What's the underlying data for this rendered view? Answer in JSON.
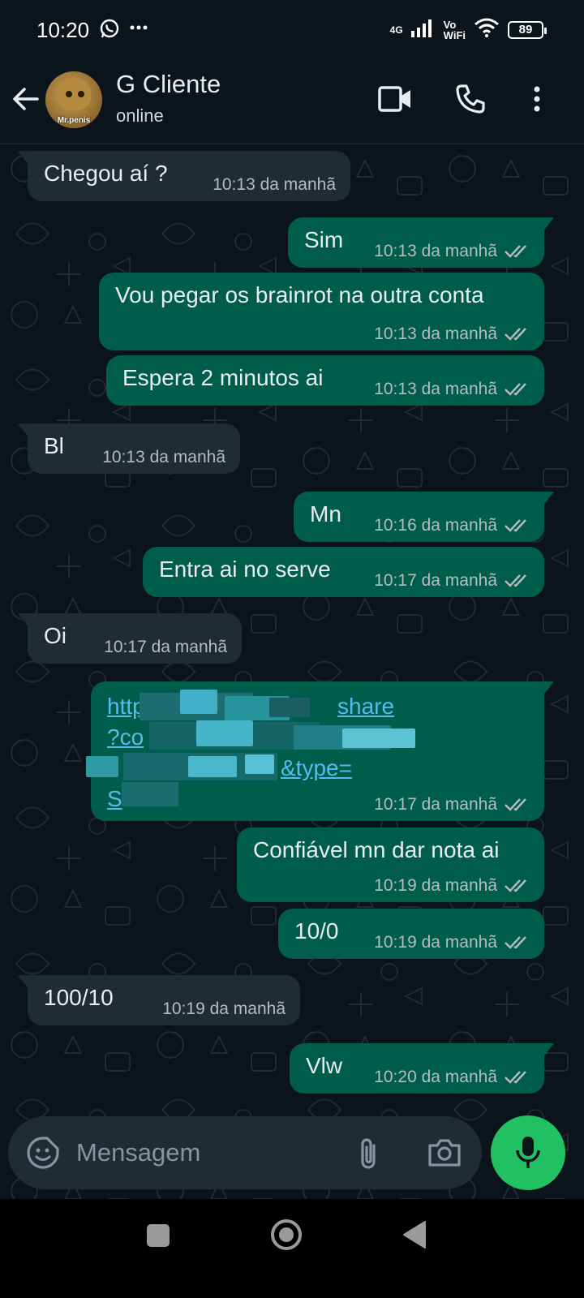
{
  "status_bar": {
    "time": "10:20",
    "network_label": "4G",
    "volte_label": "Vo\nWiFi",
    "battery": "89",
    "icons": [
      "whatsapp-icon",
      "more-notifications-icon",
      "signal-icon",
      "wifi-icon",
      "battery-icon"
    ]
  },
  "header": {
    "contact_name": "G Cliente",
    "contact_status": "online",
    "avatar_caption": "Mr.penis",
    "icons": [
      "back-arrow-icon",
      "video-call-icon",
      "voice-call-icon",
      "more-options-icon"
    ]
  },
  "messages": [
    {
      "direction": "in",
      "text": "Chegou aí ?",
      "time": "10:13 da manhã"
    },
    {
      "direction": "out",
      "text": "Sim",
      "time": "10:13 da manhã",
      "status": "read"
    },
    {
      "direction": "out",
      "text": "Vou pegar os brainrot na outra conta",
      "time": "10:13 da manhã",
      "status": "read"
    },
    {
      "direction": "out",
      "text": "Espera 2 minutos ai",
      "time": "10:13 da manhã",
      "status": "read"
    },
    {
      "direction": "in",
      "text": "Bl",
      "time": "10:13 da manhã"
    },
    {
      "direction": "out",
      "text": "Mn",
      "time": "10:16 da manhã",
      "status": "read"
    },
    {
      "direction": "out",
      "text": "Entra ai no serve",
      "time": "10:17 da manhã",
      "status": "read"
    },
    {
      "direction": "in",
      "text": "Oi",
      "time": "10:17 da manhã"
    },
    {
      "direction": "out",
      "type": "link",
      "lines": [
        "https://",
        "?co",
        "",
        "S"
      ],
      "visible_fragments": [
        "share",
        "&type="
      ],
      "time": "10:17 da manhã",
      "status": "read",
      "redacted": true
    },
    {
      "direction": "out",
      "text": "Confiável mn dar nota ai",
      "time": "10:19 da manhã",
      "status": "read"
    },
    {
      "direction": "out",
      "text": "10/0",
      "time": "10:19 da manhã",
      "status": "read"
    },
    {
      "direction": "in",
      "text": "100/10",
      "time": "10:19 da manhã"
    },
    {
      "direction": "out",
      "text": "Vlw",
      "time": "10:20 da manhã",
      "status": "read"
    }
  ],
  "composer": {
    "placeholder": "Mensagem",
    "icons": [
      "sticker-icon",
      "attach-icon",
      "camera-icon",
      "mic-icon"
    ]
  },
  "navbar": {
    "icons": [
      "recent-apps-icon",
      "home-icon",
      "back-icon"
    ]
  },
  "colors": {
    "background": "#0b141a",
    "incoming_bubble": "#202c33",
    "outgoing_bubble": "#005c4b",
    "link": "#53bdeb",
    "mic_button": "#21c063"
  }
}
